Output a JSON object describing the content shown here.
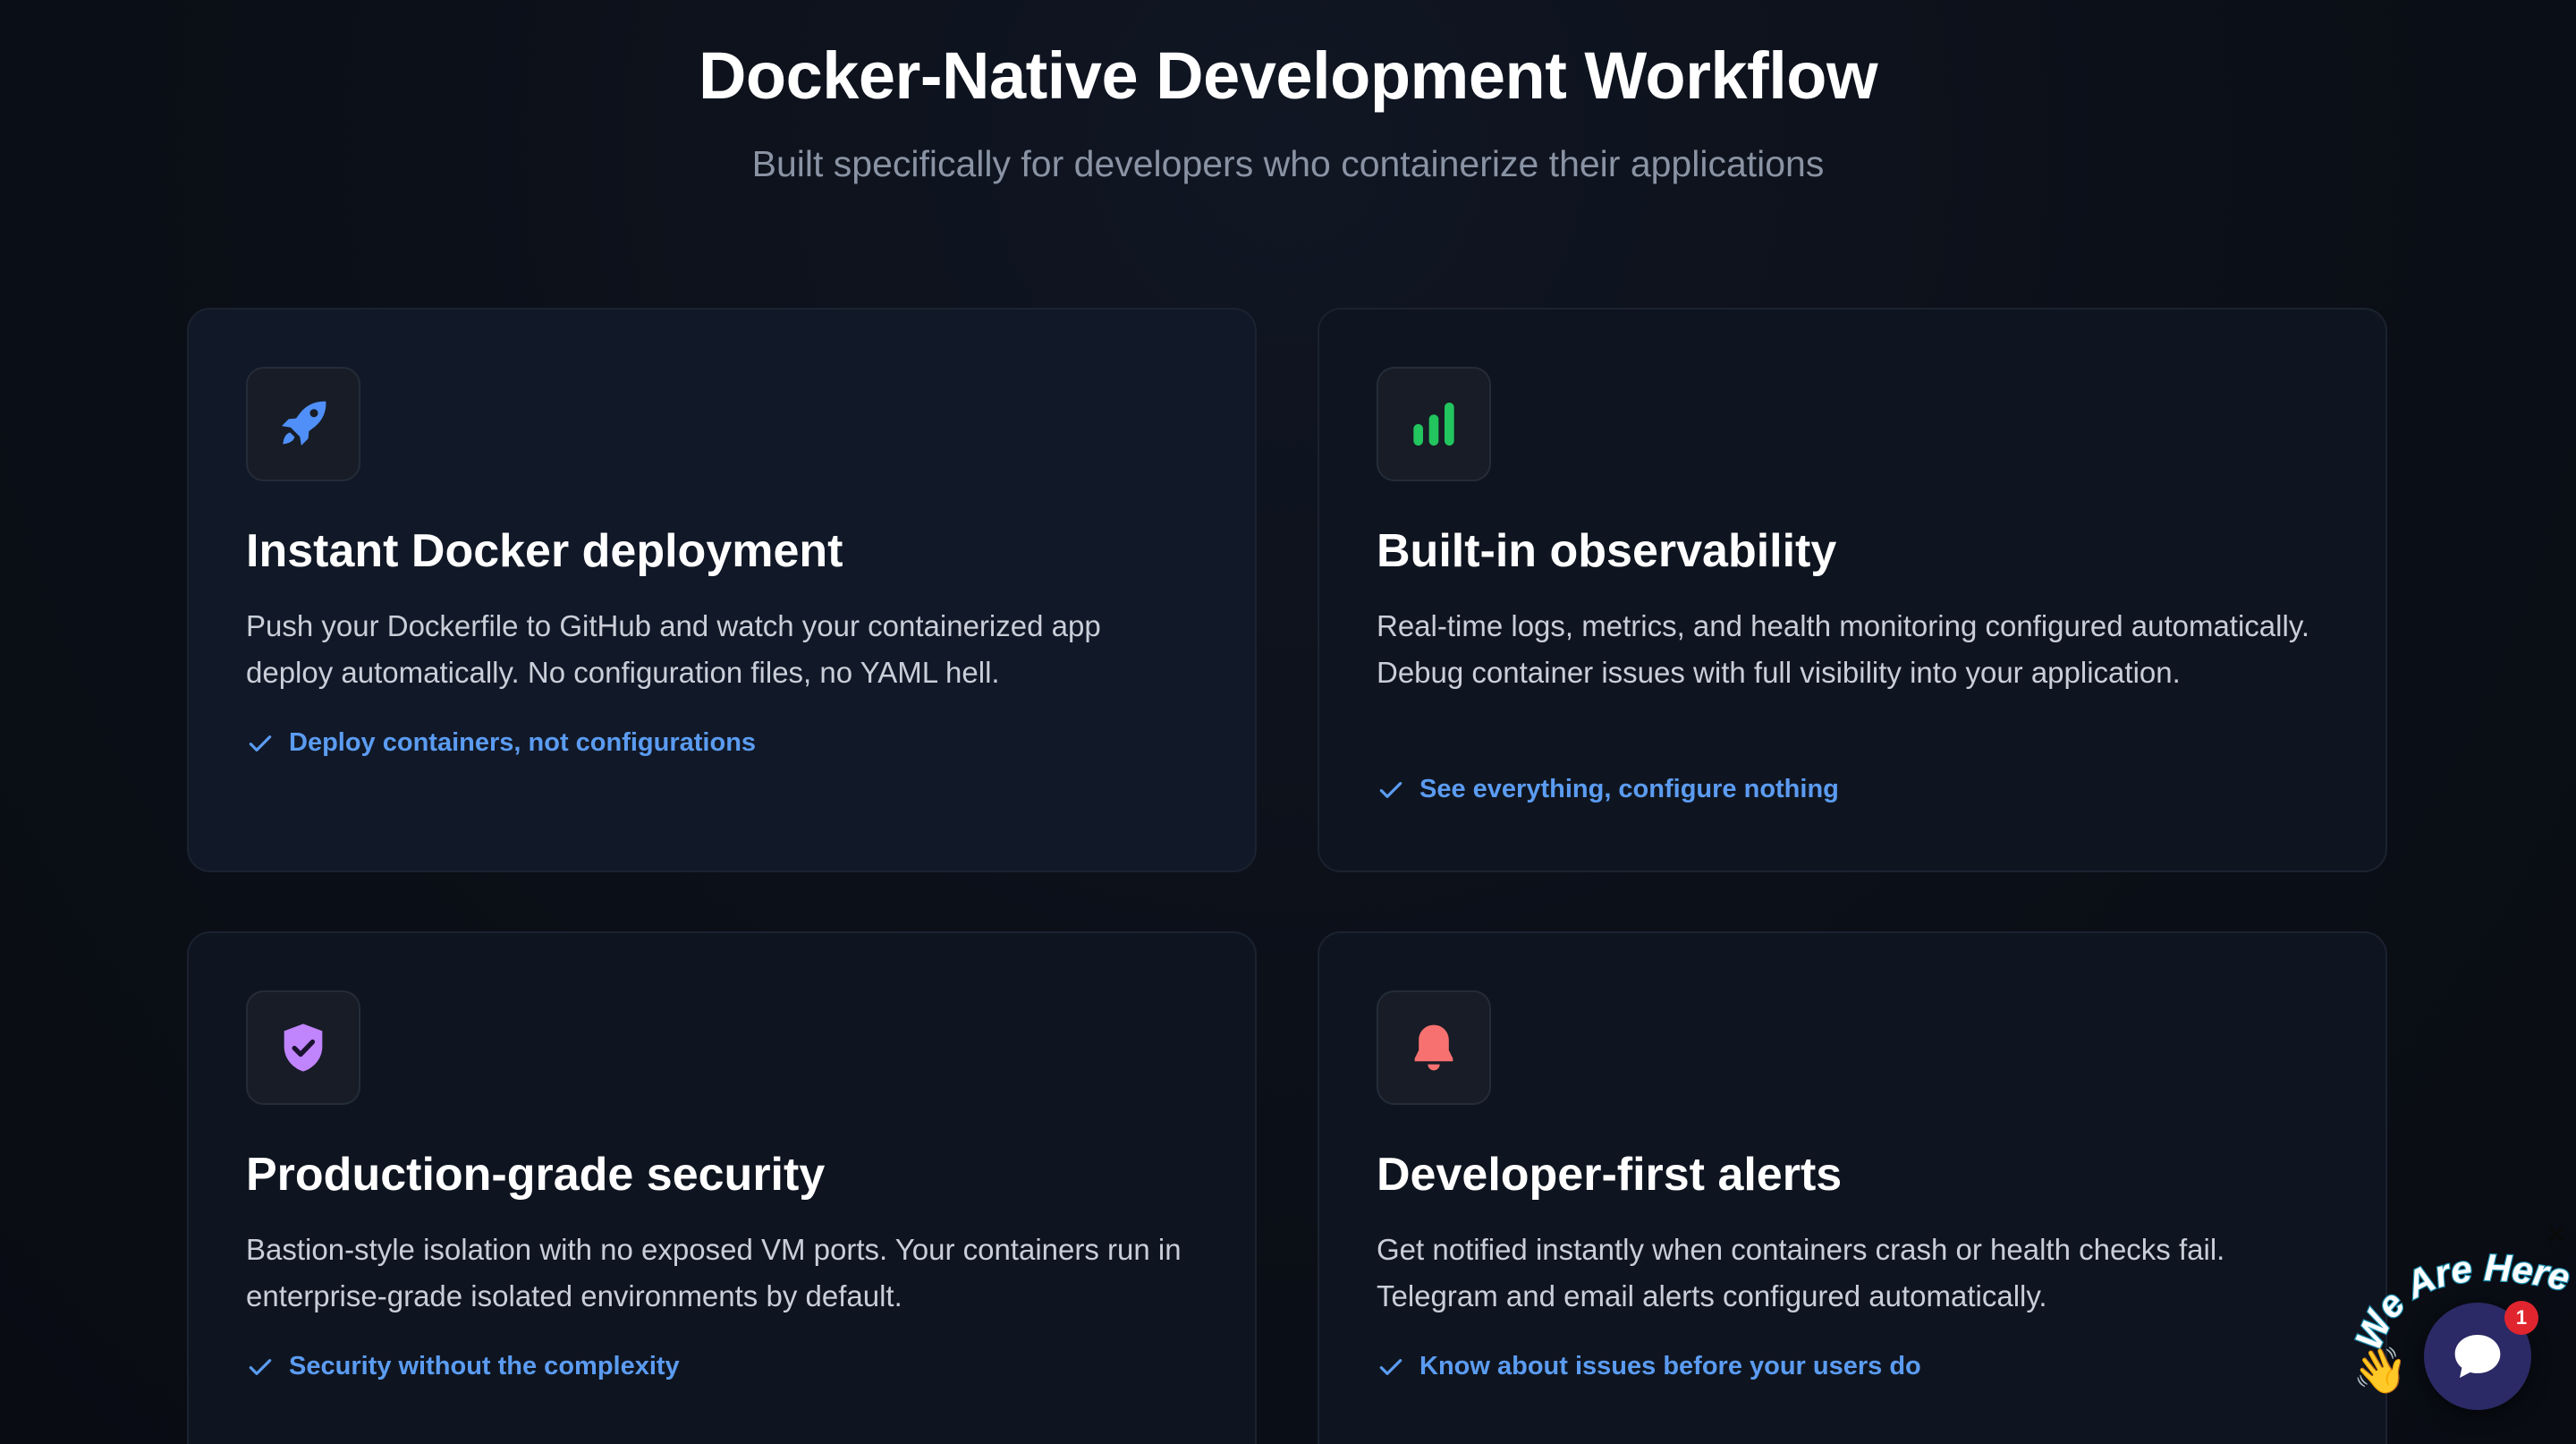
{
  "header": {
    "title": "Docker-Native Development Workflow",
    "subtitle": "Built specifically for developers who containerize their applications"
  },
  "features": [
    {
      "icon": "rocket-icon",
      "icon_color": "#4f8ff7",
      "title": "Instant Docker deployment",
      "description": "Push your Dockerfile to GitHub and watch your containerized app deploy automatically. No configuration files, no YAML hell.",
      "highlight": "Deploy containers, not configurations"
    },
    {
      "icon": "bar-chart-icon",
      "icon_color": "#22c55e",
      "title": "Built-in observability",
      "description": "Real-time logs, metrics, and health monitoring configured automatically. Debug container issues with full visibility into your application.",
      "highlight": "See everything, configure nothing"
    },
    {
      "icon": "shield-check-icon",
      "icon_color": "#c084fc",
      "title": "Production-grade security",
      "description": "Bastion-style isolation with no exposed VM ports. Your containers run in enterprise-grade isolated environments by default.",
      "highlight": "Security without the complexity"
    },
    {
      "icon": "bell-icon",
      "icon_color": "#f87171",
      "title": "Developer-first alerts",
      "description": "Get notified instantly when containers crash or health checks fail. Telegram and email alerts configured automatically.",
      "highlight": "Know about issues before your users do"
    }
  ],
  "chat_widget": {
    "banner": "We Are Here!",
    "badge_count": "1",
    "close_symbol": "×",
    "hand_emoji": "👋"
  },
  "colors": {
    "background": "#0b0f17",
    "card": "#0f1520",
    "accent_link": "#5b9cf2",
    "chat_bubble": "#2b2a66",
    "badge": "#e0252f"
  }
}
